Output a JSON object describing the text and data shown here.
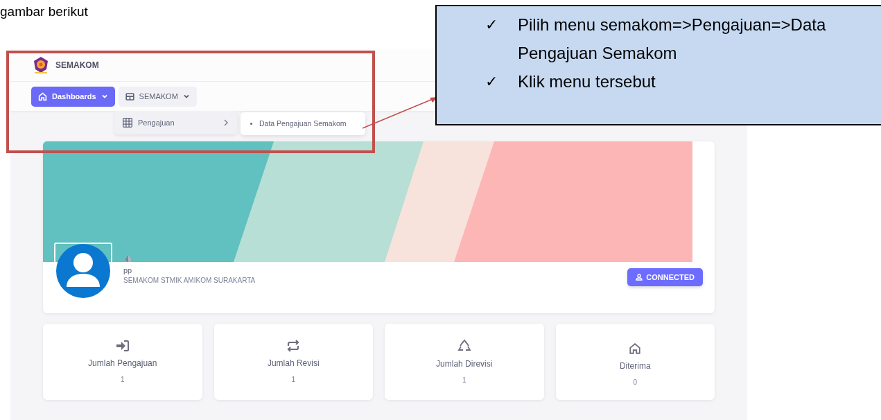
{
  "document_text": "gambar berikut",
  "app": {
    "brand": "SEMAKOM",
    "nav": [
      {
        "label": "Dashboards",
        "selected": true
      },
      {
        "label": "SEMAKOM",
        "selected": false
      }
    ],
    "dropdown": {
      "item": "Pengajuan",
      "submenu": [
        "Data Pengajuan Semakom"
      ]
    },
    "profile": {
      "name": "pp",
      "organization": "SEMAKOM STMIK AMIKOM SURAKARTA",
      "button": "CONNECTED"
    },
    "stats": [
      {
        "label": "Jumlah Pengajuan",
        "value": "1"
      },
      {
        "label": "Jumlah Revisi",
        "value": "1"
      },
      {
        "label": "Jumlah Direvisi",
        "value": "1"
      },
      {
        "label": "Diterima",
        "value": "0"
      }
    ]
  },
  "callout": {
    "items": [
      {
        "marker": "✓",
        "text": "Pilih menu semakom=>Pengajuan=>Data Pengajuan Semakom"
      },
      {
        "marker": "✓",
        "text": "Klik menu tersebut"
      }
    ]
  }
}
